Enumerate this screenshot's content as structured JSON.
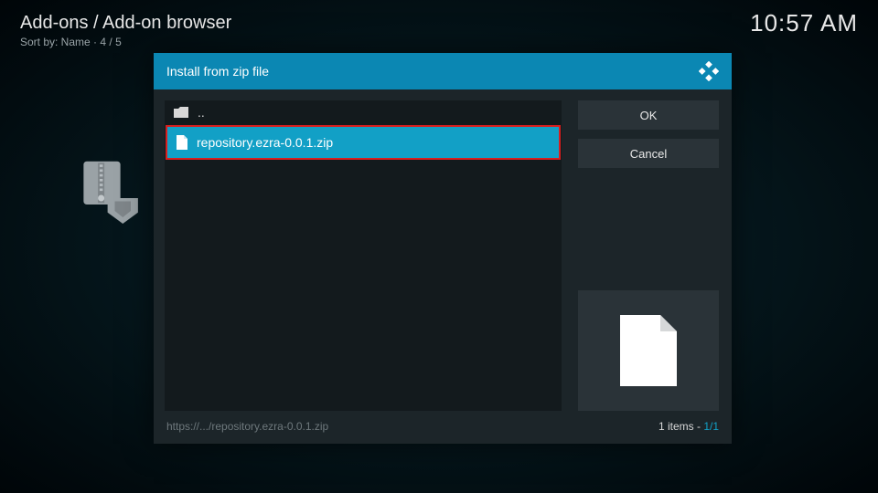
{
  "header": {
    "breadcrumb": "Add-ons / Add-on browser",
    "sort_label": "Sort by: Name",
    "page_pos": "4 / 5",
    "clock": "10:57 AM"
  },
  "dialog": {
    "title": "Install from zip file",
    "parent_label": "..",
    "file_label": "repository.ezra-0.0.1.zip",
    "ok_label": "OK",
    "cancel_label": "Cancel",
    "path_display": "https://.../repository.ezra-0.0.1.zip",
    "items_word": "items",
    "items_count": "1",
    "items_total": "1/1"
  },
  "colors": {
    "accent": "#12a0c6",
    "header_blue": "#0b87b3",
    "highlight_border": "#d91e1e",
    "panel": "#1c2529",
    "panel_dark": "#131a1d"
  }
}
